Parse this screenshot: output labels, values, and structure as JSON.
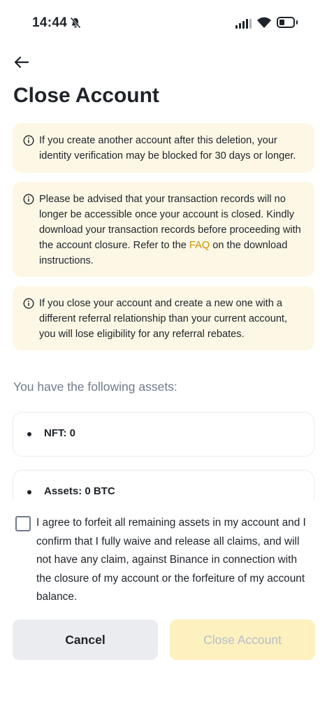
{
  "status_bar": {
    "time": "14:44"
  },
  "page": {
    "title": "Close Account"
  },
  "notices": [
    {
      "text": "If you create another account after this deletion, your identity verification may be blocked for 30 days or longer."
    },
    {
      "text_before": "Please be advised that your transaction records will no longer be accessible once your account is closed. Kindly download your transaction records before proceeding with the account closure. Refer to the ",
      "link": "FAQ",
      "text_after": " on the download instructions."
    },
    {
      "text": "If you close your account and create a new one with a different referral relationship than your current account, you will lose eligibility for any referral rebates."
    }
  ],
  "assets": {
    "heading": "You have the following assets:",
    "items": [
      {
        "label": "NFT: 0"
      },
      {
        "label": "Assets: 0 BTC"
      }
    ]
  },
  "agreement": {
    "text": "I agree to forfeit all remaining assets in my account and I confirm that I fully waive and release all claims, and will not have any claim, against Binance in connection with the closure of my account or the forfeiture of my account balance.",
    "checked": false
  },
  "actions": {
    "cancel_label": "Cancel",
    "close_label": "Close Account"
  },
  "colors": {
    "accent": "#c99400",
    "notice_bg": "#fdf8e6",
    "disabled_button_bg": "#fdf1c0"
  },
  "icons": [
    "bell-off-icon",
    "signal-icon",
    "wifi-icon",
    "battery-icon",
    "back-arrow-icon",
    "info-icon"
  ]
}
